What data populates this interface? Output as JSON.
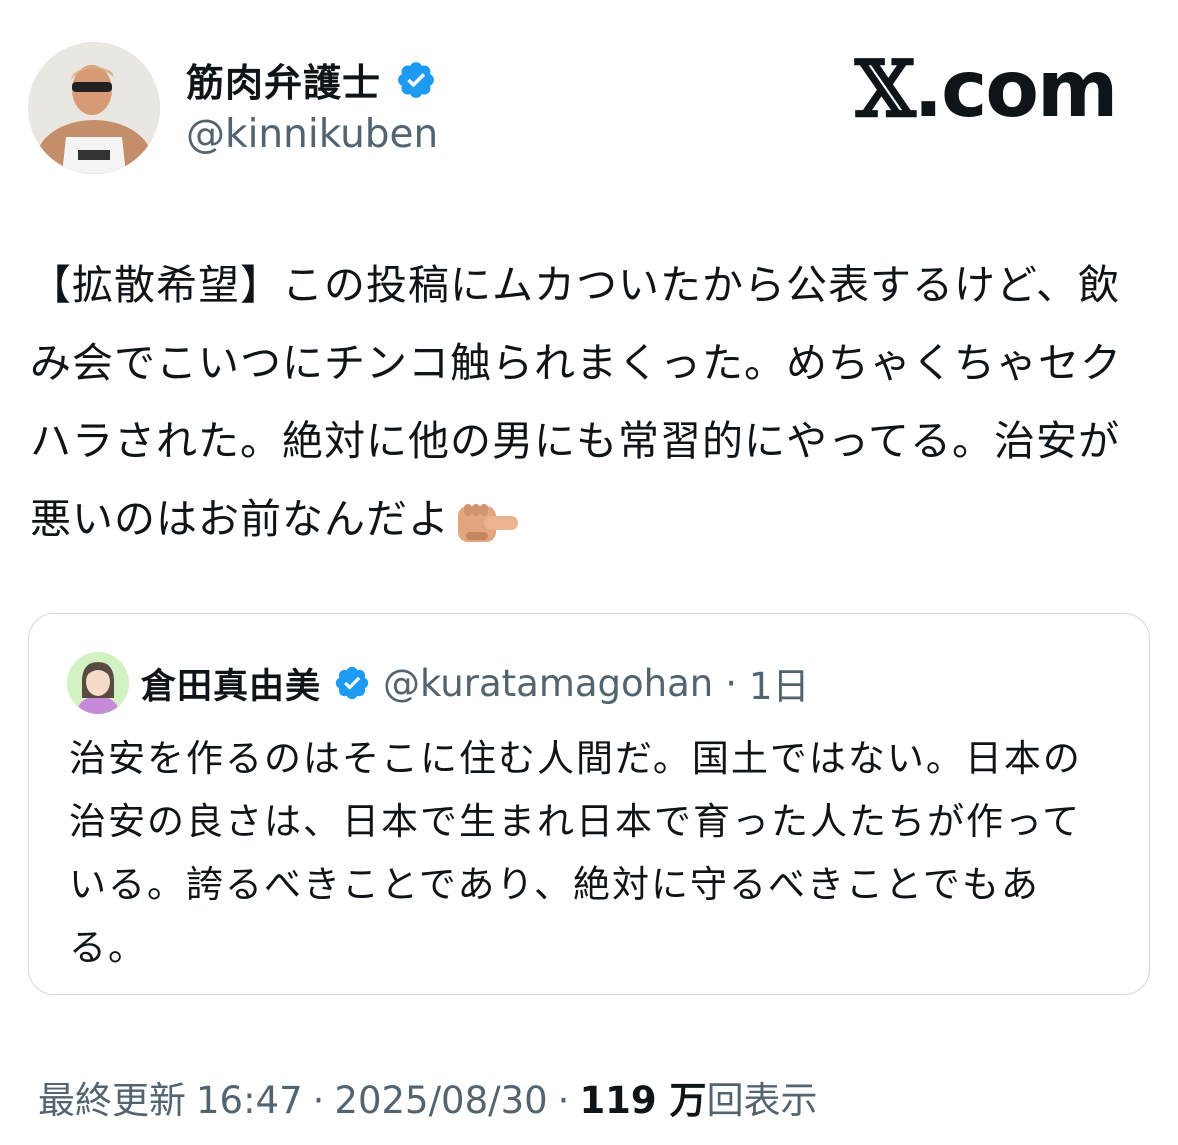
{
  "author": {
    "display_name": "筋肉弁護士",
    "handle": "@kinnikuben",
    "avatar_icon": "profile-photo",
    "verified_icon": "verified-badge-icon"
  },
  "brand": {
    "logo_text": ".com",
    "logo_icon": "x-logo"
  },
  "post": {
    "text": "【拡散希望】この投稿にムカついたから公表するけど、飲み会でこいつにチンコ触られまくった。めちゃくちゃセクハラされた。絶対に他の男にも常習的にやってる。治安が悪いのはお前なんだよ",
    "emoji_icon": "pointing-finger-emoji"
  },
  "quote": {
    "display_name": "倉田真由美",
    "handle": "@kuratamagohan",
    "separator": "·",
    "time": "1日",
    "text": "治安を作るのはそこに住む人間だ。国土ではない。日本の治安の良さは、日本で生まれ日本で育った人たちが作っている。誇るべきことであり、絶対に守るべきことでもある。"
  },
  "meta": {
    "updated_label": "最終更新",
    "time": "16:47",
    "dot1": "·",
    "date": "2025/08/30",
    "dot2": "·",
    "view_count": "119 万",
    "views_label": "回表示"
  },
  "colors": {
    "verified_blue": "#1d9bf0",
    "secondary_text": "#536471",
    "border": "#cfd9de"
  }
}
